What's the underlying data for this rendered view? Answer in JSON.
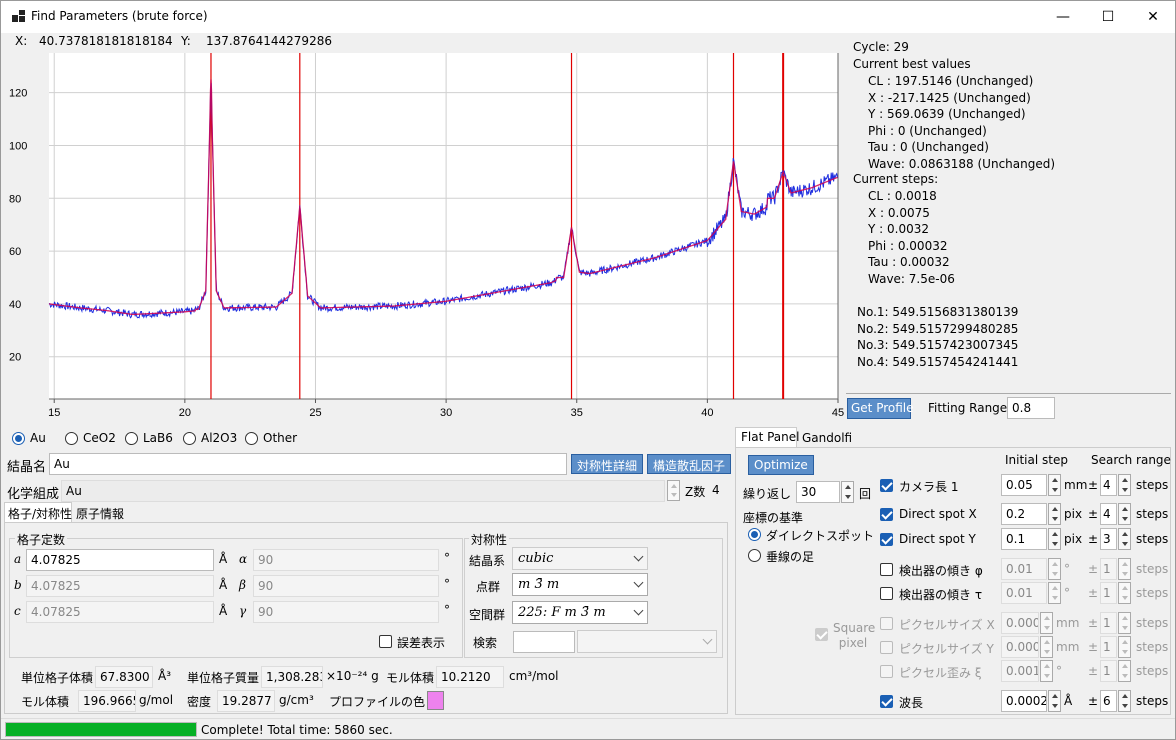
{
  "window": {
    "title": "Find Parameters (brute force)",
    "min": "—",
    "max": "☐",
    "close": "✕"
  },
  "coords": {
    "x_label": "X:",
    "x_value": "40.737818181818184",
    "y_label": "Y:",
    "y_value": "137.8764144279286"
  },
  "chart_data": {
    "type": "line",
    "x_ticks": [
      "15",
      "20",
      "25",
      "30",
      "35",
      "40",
      "45"
    ],
    "y_ticks": [
      "20",
      "40",
      "60",
      "80",
      "100",
      "120"
    ],
    "xlim": [
      14.8,
      45
    ],
    "ylim": [
      4,
      135
    ],
    "peaks": [
      21.0,
      24.4,
      34.8,
      41.0,
      42.9
    ],
    "series": [
      {
        "color": "#1f2fe0",
        "kind": "measured"
      },
      {
        "color": "#d4004f",
        "kind": "calculated"
      }
    ],
    "profile_points": [
      [
        14.8,
        40
      ],
      [
        16,
        38.5
      ],
      [
        17,
        37.5
      ],
      [
        18,
        36
      ],
      [
        19,
        36.5
      ],
      [
        20,
        37
      ],
      [
        20.5,
        37.5
      ],
      [
        20.8,
        45
      ],
      [
        21.0,
        125
      ],
      [
        21.2,
        45
      ],
      [
        21.5,
        38.5
      ],
      [
        23.5,
        38.8
      ],
      [
        24.1,
        44
      ],
      [
        24.4,
        77
      ],
      [
        24.7,
        43
      ],
      [
        25.2,
        38.5
      ],
      [
        28,
        39.2
      ],
      [
        30,
        41
      ],
      [
        32,
        44.5
      ],
      [
        34,
        48
      ],
      [
        34.5,
        50
      ],
      [
        34.8,
        69
      ],
      [
        35.1,
        52
      ],
      [
        35.5,
        51.5
      ],
      [
        38,
        57.5
      ],
      [
        40,
        64
      ],
      [
        40.7,
        72
      ],
      [
        41.0,
        94
      ],
      [
        41.3,
        75
      ],
      [
        41.8,
        74
      ],
      [
        42.5,
        78
      ],
      [
        42.9,
        90
      ],
      [
        43.2,
        82
      ],
      [
        44,
        84
      ],
      [
        45,
        88
      ]
    ]
  },
  "status_text": {
    "cycle": "Cycle: 29",
    "best_header": "Current best values",
    "best": [
      "CL  : 197.5146 (Unchanged)",
      "X   : -217.1425 (Unchanged)",
      "Y   : 569.0639 (Unchanged)",
      "Phi : 0 (Unchanged)",
      "Tau : 0 (Unchanged)",
      "Wave: 0.0863188 (Unchanged)"
    ],
    "steps_header": "Current steps:",
    "steps": [
      "CL  : 0.0018",
      "X   : 0.0075",
      "Y   : 0.0032",
      "Phi : 0.00032",
      "Tau : 0.00032",
      "Wave: 7.5e-06"
    ],
    "results": [
      "No.1: 549.5156831380139",
      "No.2: 549.5157299480285",
      "No.3: 549.5157423007345",
      "No.4: 549.5157454241441"
    ]
  },
  "profile": {
    "get_button": "Get Profile",
    "fitting_label": "Fitting Range",
    "fitting_value": "0.8"
  },
  "materials": {
    "options": [
      "Au",
      "CeO2",
      "LaB6",
      "Al2O3",
      "Other"
    ],
    "selected": "Au"
  },
  "crystal": {
    "name_label": "結晶名",
    "name_value": "Au",
    "symmetry_btn": "対称性詳細",
    "scatter_btn": "構造散乱因子",
    "formula_label": "化学組成",
    "formula_value": "Au",
    "z_label": "Z数",
    "z_value": "4",
    "tabs": [
      "格子/対称性",
      "原子情報"
    ]
  },
  "lattice": {
    "title": "格子定数",
    "a_lbl": "a",
    "a_val": "4.07825",
    "b_lbl": "b",
    "b_val": "4.07825",
    "c_lbl": "c",
    "c_val": "4.07825",
    "unit_a": "Å",
    "alpha_lbl": "α",
    "alpha_val": "90",
    "beta_lbl": "β",
    "beta_val": "90",
    "gamma_lbl": "γ",
    "gamma_val": "90",
    "deg": "°",
    "error_label": "誤差表示"
  },
  "symmetry": {
    "title": "対称性",
    "system_label": "結晶系",
    "system_value": "cubic",
    "point_label": "点群",
    "point_value": "m 3̄ m",
    "space_label": "空間群",
    "space_value": "225: F m 3̄ m",
    "search_label": "検索"
  },
  "props": {
    "cell_vol_label": "単位格子体積",
    "cell_vol_value": "67.8300",
    "cell_vol_unit": "Å³",
    "cell_mass_label": "単位格子質量",
    "cell_mass_value": "1,308.2834",
    "cell_mass_unit": "×10⁻²⁴ g",
    "molar_vol_label": "モル体積",
    "molar_vol_value": "10.2120",
    "molar_vol_unit": "cm³/mol",
    "molar_mass_label": "モル体積",
    "molar_mass_value": "196.9665",
    "molar_mass_unit": "g/mol",
    "density_label": "密度",
    "density_value": "19.2877",
    "density_unit": "g/cm³",
    "color_label": "プロファイルの色",
    "color_hex": "#ee82ee"
  },
  "right_tabs": [
    "Flat Panel",
    "Gandolfi"
  ],
  "optimize": {
    "button": "Optimize",
    "repeat_label": "繰り返し",
    "repeat_value": "30",
    "repeat_unit": "回",
    "basis_title": "座標の基準",
    "basis_options": [
      "ダイレクトスポット",
      "垂線の足"
    ],
    "square_pixel": "Square pixel",
    "col_step": "Initial step",
    "col_range": "Search range",
    "rows": [
      {
        "label": "カメラ長 1",
        "checked": true,
        "enabled": true,
        "step": "0.05",
        "unit": "mm",
        "pm": "±",
        "range": "4",
        "steps": "steps"
      },
      {
        "label": "Direct spot X",
        "checked": true,
        "enabled": true,
        "step": "0.2",
        "unit": "pix",
        "pm": "±",
        "range": "4",
        "steps": "steps"
      },
      {
        "label": "Direct spot Y",
        "checked": true,
        "enabled": true,
        "step": "0.1",
        "unit": "pix",
        "pm": "±",
        "range": "3",
        "steps": "steps"
      },
      {
        "label": "検出器の傾き φ",
        "checked": false,
        "enabled": true,
        "step": "0.01",
        "unit": "°",
        "pm": "±",
        "range": "1",
        "steps": "steps"
      },
      {
        "label": "検出器の傾き τ",
        "checked": false,
        "enabled": true,
        "step": "0.01",
        "unit": "°",
        "pm": "±",
        "range": "1",
        "steps": "steps"
      },
      {
        "label": "ピクセルサイズ X",
        "checked": false,
        "enabled": false,
        "step": "0.0001",
        "unit": "mm",
        "pm": "±",
        "range": "1",
        "steps": "steps"
      },
      {
        "label": "ピクセルサイズ Y",
        "checked": false,
        "enabled": false,
        "step": "0.0001",
        "unit": "mm",
        "pm": "±",
        "range": "1",
        "steps": "steps"
      },
      {
        "label": "ピクセル歪み ξ",
        "checked": false,
        "enabled": false,
        "step": "0.001",
        "unit": "°",
        "pm": "±",
        "range": "1",
        "steps": "steps"
      },
      {
        "label": "波長",
        "checked": true,
        "enabled": true,
        "step": "0.0002",
        "unit": "Å",
        "pm": "±",
        "range": "6",
        "steps": "steps"
      }
    ]
  },
  "statusbar": {
    "progress": 1.0,
    "text": "Complete! Total time: 5860 sec."
  }
}
